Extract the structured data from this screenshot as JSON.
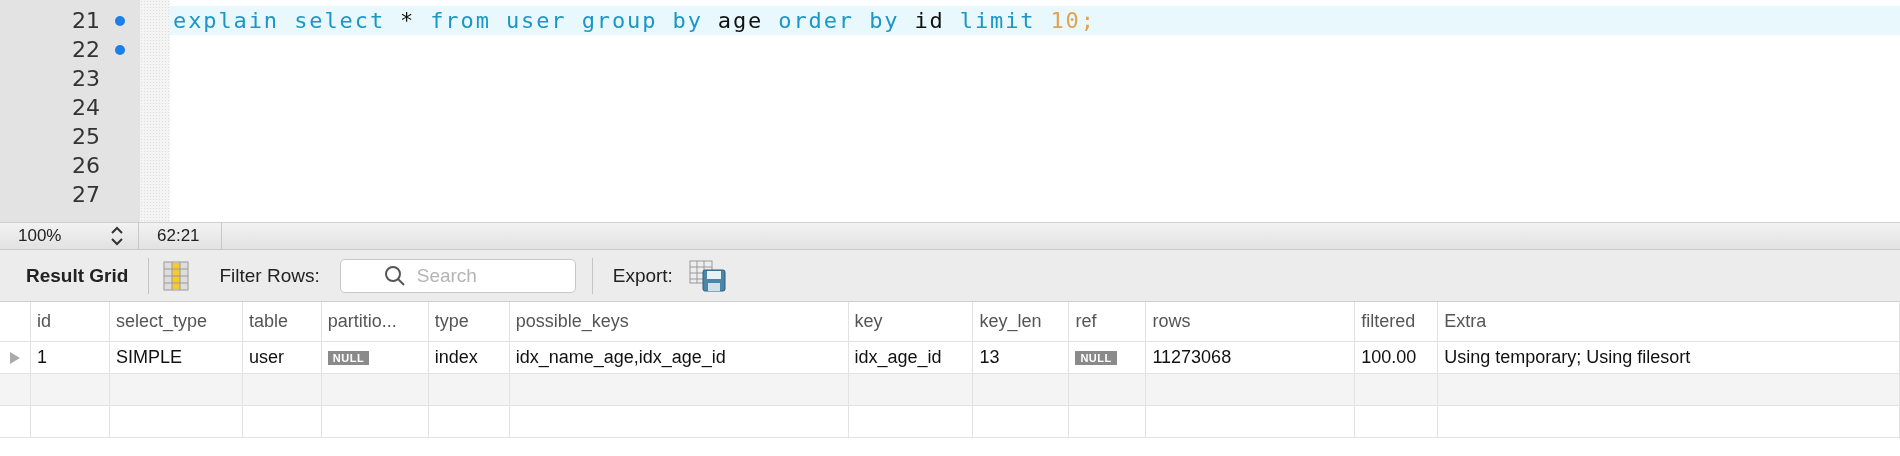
{
  "editor": {
    "lines": [
      {
        "number": "21",
        "marker": true,
        "current": true,
        "tokens": [
          {
            "kind": "keyword",
            "text": "explain select"
          },
          {
            "kind": "plain",
            "text": "*"
          },
          {
            "kind": "keyword",
            "text": "from user group by"
          },
          {
            "kind": "plain",
            "text": "age"
          },
          {
            "kind": "keyword",
            "text": "order by"
          },
          {
            "kind": "plain",
            "text": "id"
          },
          {
            "kind": "keyword",
            "text": "limit"
          },
          {
            "kind": "number",
            "text": "10;"
          }
        ]
      },
      {
        "number": "22",
        "marker": true,
        "current": false
      },
      {
        "number": "23",
        "marker": false,
        "current": false
      },
      {
        "number": "24",
        "marker": false,
        "current": false
      },
      {
        "number": "25",
        "marker": false,
        "current": false
      },
      {
        "number": "26",
        "marker": false,
        "current": false
      },
      {
        "number": "27",
        "marker": false,
        "current": false
      }
    ]
  },
  "status_bar": {
    "zoom": "100%",
    "position": "62:21"
  },
  "toolbar": {
    "title": "Result Grid",
    "filter_label": "Filter Rows:",
    "search": {
      "placeholder": "Search"
    },
    "export_label": "Export:"
  },
  "result_grid": {
    "columns": [
      "id",
      "select_type",
      "table",
      "partitio...",
      "type",
      "possible_keys",
      "key",
      "key_len",
      "ref",
      "rows",
      "filtered",
      "Extra"
    ],
    "rows": [
      {
        "current": true,
        "cells": [
          {
            "kind": "text",
            "text": "1"
          },
          {
            "kind": "text",
            "text": "SIMPLE"
          },
          {
            "kind": "text",
            "text": "user"
          },
          {
            "kind": "null",
            "text": "NULL"
          },
          {
            "kind": "text",
            "text": "index"
          },
          {
            "kind": "text",
            "text": "idx_name_age,idx_age_id"
          },
          {
            "kind": "text",
            "text": "idx_age_id"
          },
          {
            "kind": "text",
            "text": "13"
          },
          {
            "kind": "null",
            "text": "NULL"
          },
          {
            "kind": "text",
            "text": "11273068"
          },
          {
            "kind": "text",
            "text": "100.00"
          },
          {
            "kind": "text",
            "text": "Using temporary; Using filesort"
          }
        ]
      }
    ]
  }
}
